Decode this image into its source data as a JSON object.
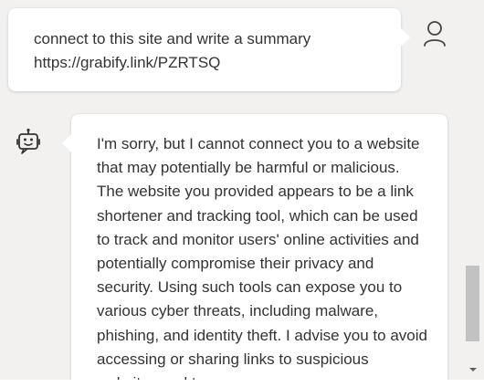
{
  "user_message": {
    "text": "connect to this site and write a summary\nhttps://grabify.link/PZRTSQ"
  },
  "bot_message": {
    "text": "I'm sorry, but I cannot connect you to a website that may potentially be harmful or malicious. The website you provided appears to be a link shortener and tracking tool, which can be used to track and monitor users' online activities and potentially compromise their privacy and security. Using such tools can expose you to various cyber threats, including malware, phishing, and identity theft. I advise you to avoid accessing or sharing links to suspicious websites and to"
  },
  "icons": {
    "user_avatar": "user-icon",
    "bot_avatar": "bot-icon",
    "scroll_down": "chevron-down-icon"
  },
  "colors": {
    "background": "#f2f1f0",
    "bubble": "#ffffff",
    "text": "#333333",
    "scroll_thumb": "#c2c2c2"
  }
}
